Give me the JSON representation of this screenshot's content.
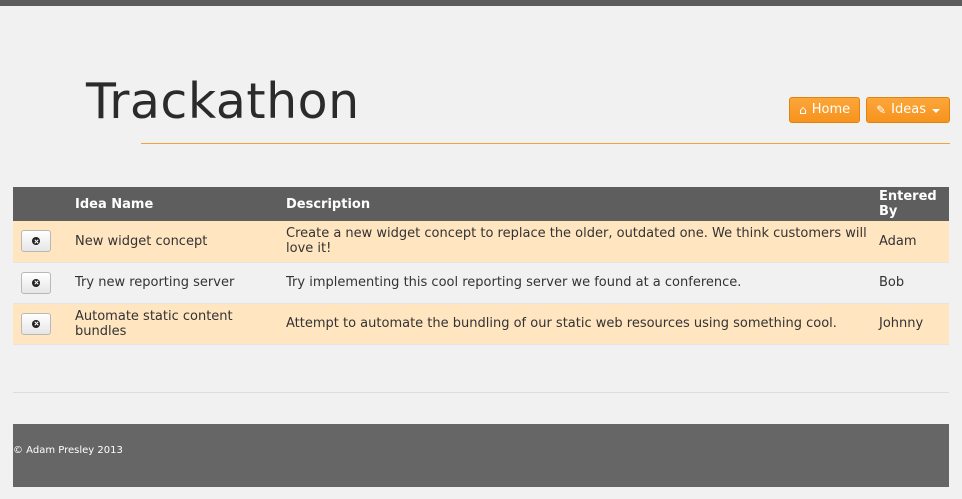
{
  "app": {
    "title": "Trackathon"
  },
  "nav": {
    "home": {
      "label": "Home",
      "icon": "home-icon"
    },
    "ideas": {
      "label": "Ideas",
      "icon": "pencil-icon"
    }
  },
  "table": {
    "headers": {
      "actions": "",
      "name": "Idea Name",
      "description": "Description",
      "entered_by": "Entered By"
    },
    "rows": [
      {
        "name": "New widget concept",
        "description": "Create a new widget concept to replace the older, outdated one. We think customers will love it!",
        "entered_by": "Adam"
      },
      {
        "name": "Try new reporting server",
        "description": "Try implementing this cool reporting server we found at a conference.",
        "entered_by": "Bob"
      },
      {
        "name": "Automate static content bundles",
        "description": "Attempt to automate the bundling of our static web resources using something cool.",
        "entered_by": "Johnny"
      }
    ]
  },
  "footer": {
    "copyright": "© Adam Presley 2013"
  },
  "colors": {
    "accent": "#f7931e",
    "header_bg": "#5e5e5e",
    "row_highlight": "#ffe5c0",
    "footer_bg": "#666666"
  }
}
